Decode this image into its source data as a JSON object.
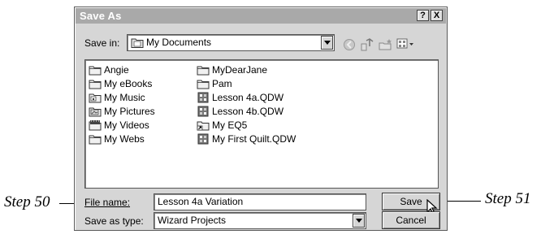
{
  "dialog": {
    "title": "Save As",
    "help_label": "?",
    "close_label": "X"
  },
  "save_in": {
    "label": "Save in:",
    "value": "My Documents"
  },
  "toolbar": {
    "icons": [
      "back-icon",
      "up-folder-icon",
      "new-folder-icon",
      "views-menu-icon"
    ]
  },
  "files": {
    "column1": [
      {
        "name": "Angie",
        "icon": "folder-icon"
      },
      {
        "name": "My eBooks",
        "icon": "folder-icon"
      },
      {
        "name": "My Music",
        "icon": "music-folder-icon"
      },
      {
        "name": "My Pictures",
        "icon": "pictures-folder-icon"
      },
      {
        "name": "My Videos",
        "icon": "video-folder-icon"
      },
      {
        "name": "My Webs",
        "icon": "folder-icon"
      }
    ],
    "column2": [
      {
        "name": "MyDearJane",
        "icon": "folder-icon"
      },
      {
        "name": "Pam",
        "icon": "folder-icon"
      },
      {
        "name": "Lesson 4a.QDW",
        "icon": "quilt-file-icon"
      },
      {
        "name": "Lesson 4b.QDW",
        "icon": "quilt-file-icon"
      },
      {
        "name": "My EQ5",
        "icon": "shortcut-icon"
      },
      {
        "name": "My First Quilt.QDW",
        "icon": "quilt-file-icon"
      }
    ]
  },
  "file_name": {
    "label": "File name:",
    "value": "Lesson 4a Variation"
  },
  "save_type": {
    "label": "Save as type:",
    "value": "Wizard Projects"
  },
  "buttons": {
    "save": "Save",
    "cancel": "Cancel"
  },
  "callouts": {
    "step50": "Step 50",
    "step51": "Step 51"
  }
}
